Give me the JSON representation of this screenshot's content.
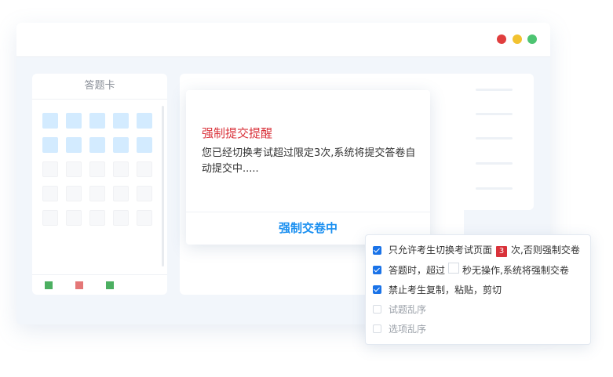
{
  "colors": {
    "dot_red": "#e03e3e",
    "dot_yellow": "#f2c230",
    "dot_green": "#4dc472",
    "legend_green": "#4caf61",
    "legend_red": "#e47777",
    "accent_blue": "#1a8ff0",
    "warning_red": "#d9323a"
  },
  "answer_card": {
    "title": "答题卡",
    "grid": {
      "columns": 5,
      "rows": 5,
      "answered_rows": 2
    }
  },
  "modal": {
    "title": "强制提交提醒",
    "body": "您已经切换考试超过限定3次,系统将提交答卷自动提交中.....",
    "action_label": "强制交卷中"
  },
  "options": [
    {
      "checked": true,
      "before": "只允许考生切换考试页面",
      "badge": "3",
      "after": "次,否则强制交卷"
    },
    {
      "checked": true,
      "before": "答题时，超过",
      "input": true,
      "after": "秒无操作,系统将强制交卷"
    },
    {
      "checked": true,
      "before": "禁止考生复制，粘贴，剪切"
    },
    {
      "checked": false,
      "before": "试题乱序"
    },
    {
      "checked": false,
      "before": "选项乱序"
    }
  ]
}
